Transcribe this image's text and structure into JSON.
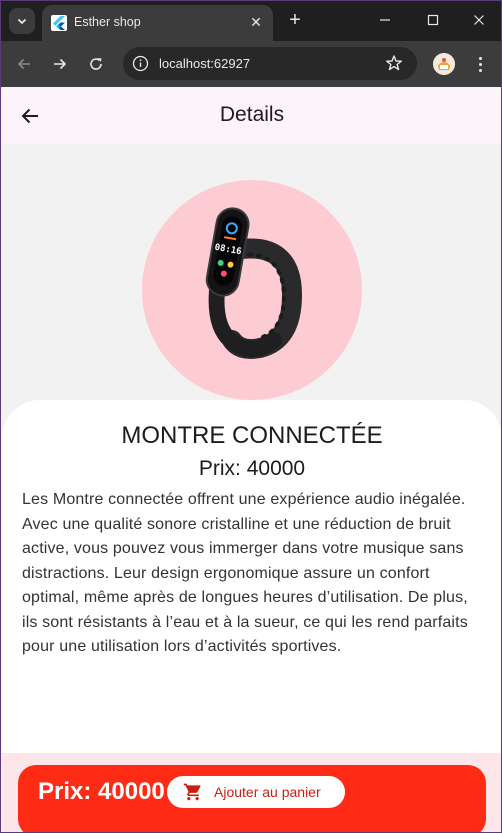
{
  "browser": {
    "tab_title": "Esther shop",
    "url": "localhost:62927"
  },
  "appbar": {
    "title": "Details"
  },
  "product": {
    "name": "MONTRE CONNECTÉE",
    "price": "Prix: 40000",
    "description": "Les Montre connectée offrent une expérience audio inégalée. Avec une qualité sonore cristalline et une réduction de bruit active, vous pouvez vous immerger dans votre musique sans distractions. Leur design ergonomique assure un confort optimal, même après de longues heures d’utilisation. De plus, ils sont résistants à l’eau et à la sueur, ce qui les rend parfaits pour une utilisation lors d’activités sportives.",
    "watch_time": "08:16",
    "hero_color": "#fdccd3"
  },
  "bottom": {
    "price": "Prix: 40000",
    "cart_label": "Ajouter au panier",
    "accent": "#ff2b14"
  },
  "icons": {
    "back": "arrow-left-icon",
    "cart": "shopping-cart-icon",
    "info": "info-icon",
    "star": "bookmark-star-icon"
  }
}
